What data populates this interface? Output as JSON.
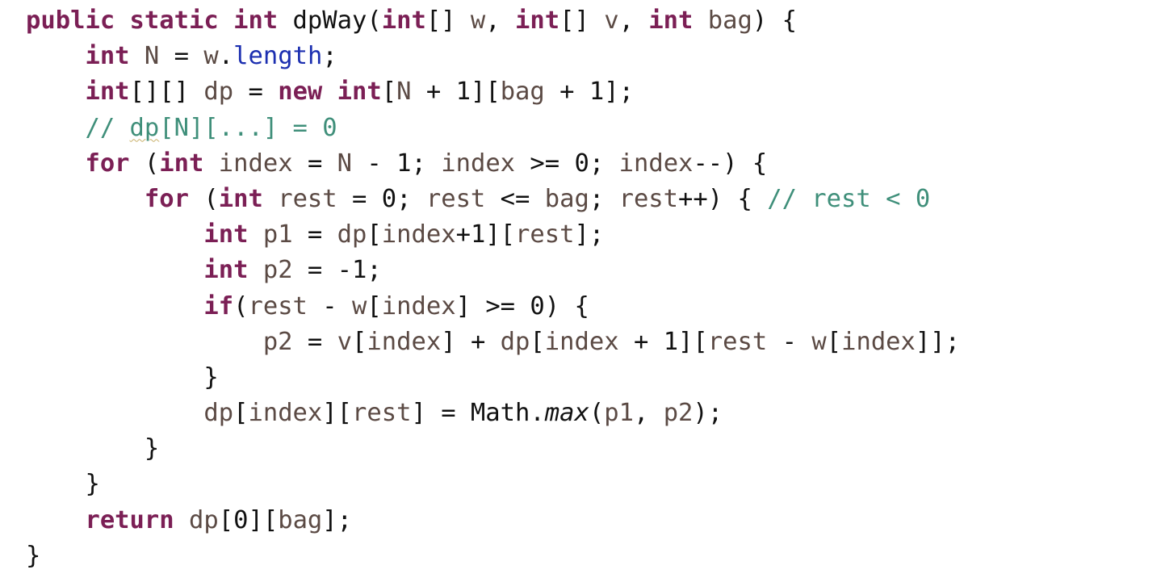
{
  "editor": {
    "lines": [
      [
        {
          "t": "public static int",
          "k": "kw"
        },
        {
          "t": " dpWay(",
          "k": "pl"
        },
        {
          "t": "int",
          "k": "kw"
        },
        {
          "t": "[] ",
          "k": "pl"
        },
        {
          "t": "w",
          "k": "id"
        },
        {
          "t": ", ",
          "k": "pl"
        },
        {
          "t": "int",
          "k": "kw"
        },
        {
          "t": "[] ",
          "k": "pl"
        },
        {
          "t": "v",
          "k": "id"
        },
        {
          "t": ", ",
          "k": "pl"
        },
        {
          "t": "int",
          "k": "kw"
        },
        {
          "t": " ",
          "k": "pl"
        },
        {
          "t": "bag",
          "k": "id"
        },
        {
          "t": ") {",
          "k": "pl"
        }
      ],
      [
        {
          "t": "    ",
          "k": "pl"
        },
        {
          "t": "int",
          "k": "kw"
        },
        {
          "t": " ",
          "k": "pl"
        },
        {
          "t": "N",
          "k": "id"
        },
        {
          "t": " = ",
          "k": "pl"
        },
        {
          "t": "w",
          "k": "id"
        },
        {
          "t": ".",
          "k": "pl"
        },
        {
          "t": "length",
          "k": "field"
        },
        {
          "t": ";",
          "k": "pl"
        }
      ],
      [
        {
          "t": "    ",
          "k": "pl"
        },
        {
          "t": "int",
          "k": "kw"
        },
        {
          "t": "[][] ",
          "k": "pl"
        },
        {
          "t": "dp",
          "k": "id"
        },
        {
          "t": " = ",
          "k": "pl"
        },
        {
          "t": "new int",
          "k": "kw"
        },
        {
          "t": "[",
          "k": "pl"
        },
        {
          "t": "N",
          "k": "id"
        },
        {
          "t": " + 1][",
          "k": "pl"
        },
        {
          "t": "bag",
          "k": "id"
        },
        {
          "t": " + 1];",
          "k": "pl"
        }
      ],
      [
        {
          "t": "    ",
          "k": "pl"
        },
        {
          "t": "// ",
          "k": "cmt"
        },
        {
          "t": "dp",
          "k": "cmt squig"
        },
        {
          "t": "[N][...] = 0",
          "k": "cmt"
        }
      ],
      [
        {
          "t": "    ",
          "k": "pl"
        },
        {
          "t": "for",
          "k": "kw"
        },
        {
          "t": " (",
          "k": "pl"
        },
        {
          "t": "int",
          "k": "kw"
        },
        {
          "t": " ",
          "k": "pl"
        },
        {
          "t": "index",
          "k": "id"
        },
        {
          "t": " = ",
          "k": "pl"
        },
        {
          "t": "N",
          "k": "id"
        },
        {
          "t": " - 1; ",
          "k": "pl"
        },
        {
          "t": "index",
          "k": "id"
        },
        {
          "t": " >= 0; ",
          "k": "pl"
        },
        {
          "t": "index",
          "k": "id"
        },
        {
          "t": "--) {",
          "k": "pl"
        }
      ],
      [
        {
          "t": "        ",
          "k": "pl"
        },
        {
          "t": "for",
          "k": "kw"
        },
        {
          "t": " (",
          "k": "pl"
        },
        {
          "t": "int",
          "k": "kw"
        },
        {
          "t": " ",
          "k": "pl"
        },
        {
          "t": "rest",
          "k": "id"
        },
        {
          "t": " = 0; ",
          "k": "pl"
        },
        {
          "t": "rest",
          "k": "id"
        },
        {
          "t": " <= ",
          "k": "pl"
        },
        {
          "t": "bag",
          "k": "id"
        },
        {
          "t": "; ",
          "k": "pl"
        },
        {
          "t": "rest",
          "k": "id"
        },
        {
          "t": "++) { ",
          "k": "pl"
        },
        {
          "t": "// rest < 0",
          "k": "cmt"
        }
      ],
      [
        {
          "t": "            ",
          "k": "pl"
        },
        {
          "t": "int",
          "k": "kw"
        },
        {
          "t": " ",
          "k": "pl"
        },
        {
          "t": "p1",
          "k": "id"
        },
        {
          "t": " = ",
          "k": "pl"
        },
        {
          "t": "dp",
          "k": "id"
        },
        {
          "t": "[",
          "k": "pl"
        },
        {
          "t": "index",
          "k": "id"
        },
        {
          "t": "+1][",
          "k": "pl"
        },
        {
          "t": "rest",
          "k": "id"
        },
        {
          "t": "];",
          "k": "pl"
        }
      ],
      [
        {
          "t": "            ",
          "k": "pl"
        },
        {
          "t": "int",
          "k": "kw"
        },
        {
          "t": " ",
          "k": "pl"
        },
        {
          "t": "p2",
          "k": "id"
        },
        {
          "t": " = -1;",
          "k": "pl"
        }
      ],
      [
        {
          "t": "            ",
          "k": "pl"
        },
        {
          "t": "if",
          "k": "kw"
        },
        {
          "t": "(",
          "k": "pl"
        },
        {
          "t": "rest",
          "k": "id"
        },
        {
          "t": " - ",
          "k": "pl"
        },
        {
          "t": "w",
          "k": "id"
        },
        {
          "t": "[",
          "k": "pl"
        },
        {
          "t": "index",
          "k": "id"
        },
        {
          "t": "] >= 0) {",
          "k": "pl"
        }
      ],
      [
        {
          "t": "                ",
          "k": "pl"
        },
        {
          "t": "p2",
          "k": "id"
        },
        {
          "t": " = ",
          "k": "pl"
        },
        {
          "t": "v",
          "k": "id"
        },
        {
          "t": "[",
          "k": "pl"
        },
        {
          "t": "index",
          "k": "id"
        },
        {
          "t": "] + ",
          "k": "pl"
        },
        {
          "t": "dp",
          "k": "id"
        },
        {
          "t": "[",
          "k": "pl"
        },
        {
          "t": "index",
          "k": "id"
        },
        {
          "t": " + 1][",
          "k": "pl"
        },
        {
          "t": "rest",
          "k": "id"
        },
        {
          "t": " - ",
          "k": "pl"
        },
        {
          "t": "w",
          "k": "id"
        },
        {
          "t": "[",
          "k": "pl"
        },
        {
          "t": "index",
          "k": "id"
        },
        {
          "t": "]];",
          "k": "pl"
        }
      ],
      [
        {
          "t": "            }",
          "k": "pl"
        }
      ],
      [
        {
          "t": "            ",
          "k": "pl"
        },
        {
          "t": "dp",
          "k": "id"
        },
        {
          "t": "[",
          "k": "pl"
        },
        {
          "t": "index",
          "k": "id"
        },
        {
          "t": "][",
          "k": "pl"
        },
        {
          "t": "rest",
          "k": "id"
        },
        {
          "t": "] = Math.",
          "k": "pl"
        },
        {
          "t": "max",
          "k": "it"
        },
        {
          "t": "(",
          "k": "pl"
        },
        {
          "t": "p1",
          "k": "id"
        },
        {
          "t": ", ",
          "k": "pl"
        },
        {
          "t": "p2",
          "k": "id"
        },
        {
          "t": ");",
          "k": "pl"
        }
      ],
      [
        {
          "t": "        }",
          "k": "pl"
        }
      ],
      [
        {
          "t": "    }",
          "k": "pl"
        }
      ],
      [
        {
          "t": "    ",
          "k": "pl"
        },
        {
          "t": "return",
          "k": "kw"
        },
        {
          "t": " ",
          "k": "pl"
        },
        {
          "t": "dp",
          "k": "id"
        },
        {
          "t": "[0][",
          "k": "pl"
        },
        {
          "t": "bag",
          "k": "id"
        },
        {
          "t": "];",
          "k": "pl"
        }
      ],
      [
        {
          "t": "}",
          "k": "pl"
        }
      ]
    ]
  }
}
